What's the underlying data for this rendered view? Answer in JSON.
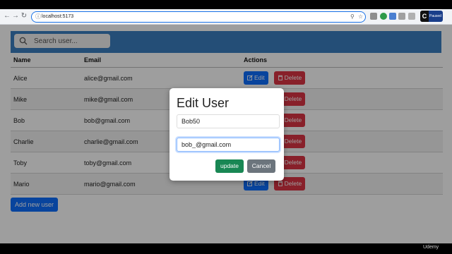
{
  "browser": {
    "url": "localhost:5173",
    "profile_initial": "C",
    "profile_label": "Paused"
  },
  "app": {
    "search_placeholder": "Search user...",
    "columns": [
      "Name",
      "Email",
      "Actions"
    ],
    "users": [
      {
        "name": "Alice",
        "email": "alice@gmail.com"
      },
      {
        "name": "Mike",
        "email": "mike@gmail.com"
      },
      {
        "name": "Bob",
        "email": "bob@gmail.com"
      },
      {
        "name": "Charlie",
        "email": "charlie@gmail.com"
      },
      {
        "name": "Toby",
        "email": "toby@gmail.com"
      },
      {
        "name": "Mario",
        "email": "mario@gmail.com"
      }
    ],
    "edit_label": "Edit",
    "delete_label": "Delete",
    "add_label": "Add new user"
  },
  "modal": {
    "title": "Edit User",
    "name_value": "Bob50",
    "email_value": "bob_@gmail.com",
    "update_label": "update",
    "cancel_label": "Cancel"
  },
  "watermark": "Udemy",
  "colors": {
    "topbar": "#3a7fc1",
    "edit": "#0d6efd",
    "delete": "#dc3545",
    "update": "#198754",
    "cancel": "#6c757d"
  }
}
